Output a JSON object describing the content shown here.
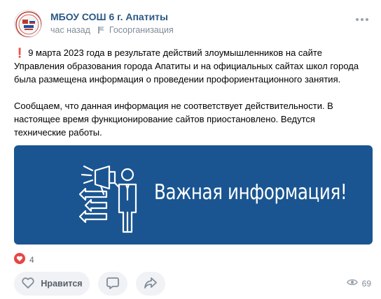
{
  "post": {
    "author": "МБОУ СОШ 6 г. Апатиты",
    "time": "час назад",
    "category": "Госорганизация",
    "paragraphs": [
      "9 марта 2023 года в результате действий злоумышленников на сайте Управления образования города Апатиты и на официальных сайтах школ города была размещена информация о проведении профориентационного занятия.",
      "Сообщаем, что данная информация не соответствует действительности. В настоящее время функционирование сайтов приостановлено. Ведутся технические работы."
    ],
    "exclamation": "❗",
    "banner_title": "Важная информация!",
    "banner_color": "#1a5591",
    "reaction_count": "4",
    "like_label": "Нравится",
    "views": "69"
  },
  "icons": {
    "pin": "pin-icon",
    "more": "more-icon",
    "heart": "heart-icon",
    "comment": "comment-icon",
    "share": "share-icon",
    "eye": "eye-icon"
  },
  "colors": {
    "accent": "#2a5885",
    "reaction": "#e64646",
    "muted": "#818c99"
  }
}
